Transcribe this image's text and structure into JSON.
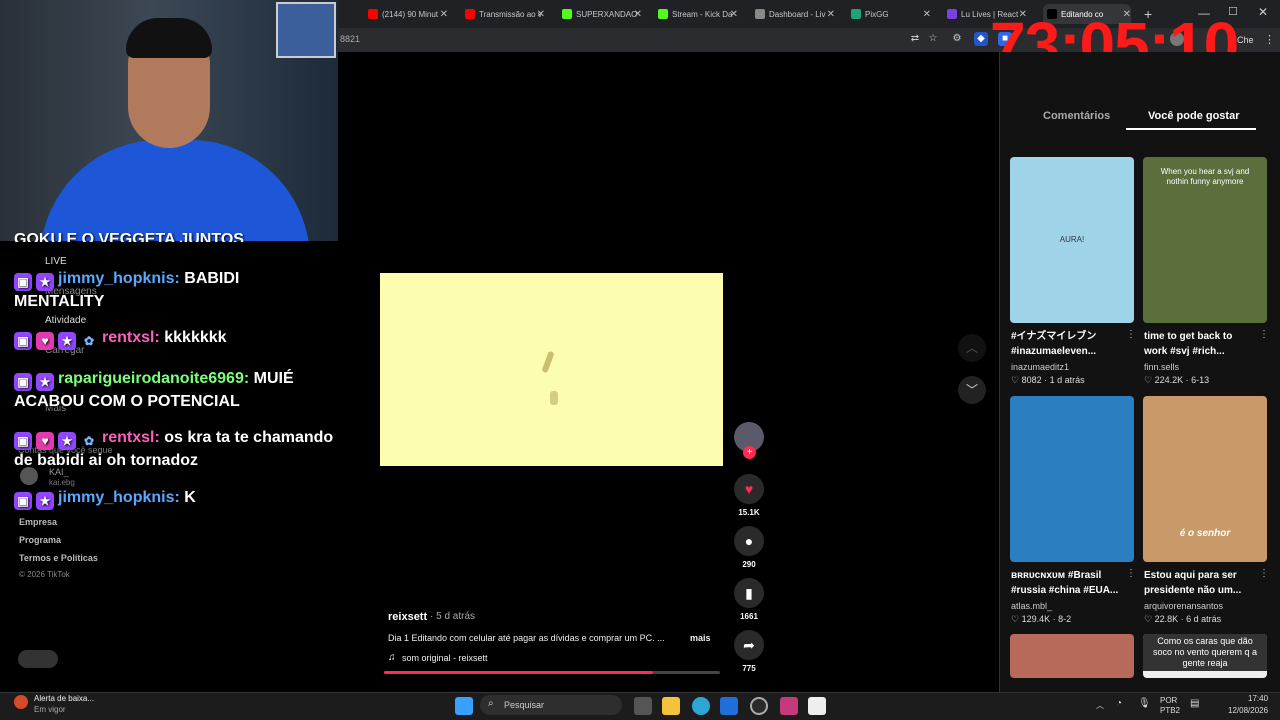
{
  "overlay": {
    "timer": "73:05:10"
  },
  "browser": {
    "tabs": [
      {
        "label": "(2144) 90 Minut",
        "color": "#ff0000"
      },
      {
        "label": "Transmissão ao v",
        "color": "#ff0000"
      },
      {
        "label": "SUPERXANDAO",
        "color": "#53fc18"
      },
      {
        "label": "Stream - Kick Da",
        "color": "#53fc18"
      },
      {
        "label": "Dashboard - Liv",
        "color": "#888888"
      },
      {
        "label": "PixGG",
        "color": "#1fa37a"
      },
      {
        "label": "Lu Lives | React",
        "color": "#7b3fe4"
      },
      {
        "label": "Editando co",
        "color": "#000000"
      }
    ],
    "url_fragment": "8821",
    "profile_label": "Che"
  },
  "sidebar": {
    "nav": [
      "LIVE",
      "Mensagens",
      "Atividade",
      "Carregar",
      "Mais"
    ],
    "following_label": "Contas que você segue",
    "following_user": "KAI_",
    "following_sub": "kai.ebg",
    "footer": [
      "Empresa",
      "Programa",
      "Termos e Políticas"
    ],
    "copyright": "© 2026 TikTok"
  },
  "chat": {
    "top_fragment": "GOKU E O VEGGETA JUNTOS",
    "messages": [
      {
        "user": "jimmy_hopknis:",
        "user_color": "#5aa9ff",
        "text": "BABIDI MENTALITY",
        "badges": [
          "twitch",
          "star"
        ]
      },
      {
        "user": "rentxsl:",
        "user_color": "#ff5fbd",
        "text": "kkkkkkk",
        "badges": [
          "twitch",
          "heart",
          "star",
          "flower"
        ]
      },
      {
        "user": "raparigueirodanoite6969:",
        "user_color": "#7dff7d",
        "text": "MUIÉ ACABOU COM O POTENCIAL",
        "badges": [
          "twitch",
          "star"
        ]
      },
      {
        "user": "rentxsl:",
        "user_color": "#ff5fbd",
        "text": "os kra ta te chamando de babidi ai oh tornadoz",
        "badges": [
          "twitch",
          "heart",
          "star",
          "flower"
        ]
      },
      {
        "user": "jimmy_hopknis:",
        "user_color": "#5aa9ff",
        "text": "K",
        "badges": [
          "twitch",
          "star"
        ]
      }
    ]
  },
  "video": {
    "author": "reixsett",
    "age": "· 5 d atrás",
    "caption": "Dia 1 Editando com celular até pagar as dívidas e comprar um PC. ...",
    "more_label": "mais",
    "sound": "som original - reixsett",
    "progress": 0.8,
    "likes": "15.1K",
    "comments": "290",
    "saves": "1661",
    "shares": "775"
  },
  "right_panel": {
    "tabs": [
      "Comentários",
      "Você pode gostar"
    ],
    "active_tab": "Você pode gostar",
    "cards": [
      {
        "title": "#イナズマイレブン #inazumaeleven...",
        "user": "inazumaeditz1",
        "views": "8082",
        "date": "1 d atrás",
        "thumb_text": "AURA!",
        "thumb_bg": "#9fd4e8"
      },
      {
        "title": "time to get back to work #svj #rich...",
        "user": "finn.sells",
        "views": "224.2K",
        "date": "6-13",
        "thumb_text": "When you hear a svj and nothin funny anymore",
        "thumb_bg": "#5b6e3c"
      },
      {
        "title": "ʙʀʀᴜᴄɴxᴜᴍ #Brasil #russia #china #EUA...",
        "user": "atlas.mbl_",
        "views": "129.4K",
        "date": "8-2",
        "thumb_text": "",
        "thumb_bg": "#2b7fc0"
      },
      {
        "title": "Estou aqui para ser presidente não um...",
        "user": "arquivorenansantos",
        "views": "22.8K",
        "date": "6 d atrás",
        "thumb_text": "é o senhor",
        "thumb_bg": "#c89a6a"
      }
    ],
    "bottom_thumb_text": "Como os caras que dão soco no vento querem q a gente reaja"
  },
  "taskbar": {
    "alert_title": "Alerta de baixa...",
    "alert_sub": "Em vigor",
    "search_placeholder": "Pesquisar",
    "lang1": "POR",
    "lang2": "PTB2",
    "time": "17:40",
    "date": "12/08/2026"
  },
  "colors": {
    "accent": "#fe2c55",
    "timer": "#ff1a1a",
    "twitch": "#9146ff"
  }
}
